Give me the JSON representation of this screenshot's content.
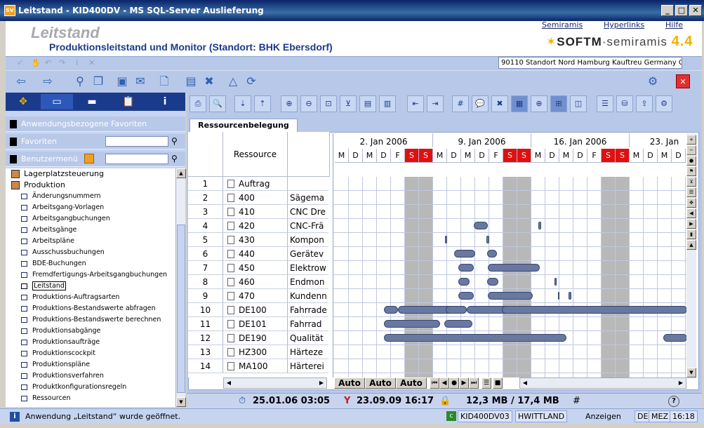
{
  "window": {
    "title": "Leitstand - KID400DV - MS SQL-Server Auslieferung",
    "app_icon": "sv",
    "buttons": {
      "minimize": "_",
      "maximize": "□",
      "close": "✕"
    }
  },
  "header": {
    "title": "Leitstand",
    "subtitle": "Produktionsleitstand und Monitor (Standort: BHK Ebersdorf)",
    "links": [
      "Semiramis",
      "Hyperlinks",
      "Hilfe"
    ],
    "logo": {
      "brand": "SOFTM",
      "product": "semiramis",
      "version": "4.4"
    },
    "address": "90110 Standort Nord Hamburg Kauftreu Germany G"
  },
  "sidebar": {
    "sections": {
      "app_favorites": "Anwendungsbezogene Favoriten",
      "favorites": "Favoriten",
      "user_menu": "Benutzermenü"
    },
    "tree": [
      {
        "label": "Lagerplatzsteuerung",
        "level": 0
      },
      {
        "label": "Produktion",
        "level": 0
      },
      {
        "label": "Änderungsnummern",
        "level": 1
      },
      {
        "label": "Arbeitsgang-Vorlagen",
        "level": 1
      },
      {
        "label": "Arbeitsgangbuchungen",
        "level": 1
      },
      {
        "label": "Arbeitsgänge",
        "level": 1
      },
      {
        "label": "Arbeitspläne",
        "level": 1
      },
      {
        "label": "Ausschussbuchungen",
        "level": 1
      },
      {
        "label": "BDE-Buchungen",
        "level": 1
      },
      {
        "label": "Fremdfertigungs-Arbeitsgangbuchungen",
        "level": 1
      },
      {
        "label": "Leitstand",
        "level": 1,
        "selected": true
      },
      {
        "label": "Produktions-Auftragsarten",
        "level": 1
      },
      {
        "label": "Produktions-Bestandswerte abfragen",
        "level": 1
      },
      {
        "label": "Produktions-Bestandswerte berechnen",
        "level": 1
      },
      {
        "label": "Produktionsabgänge",
        "level": 1
      },
      {
        "label": "Produktionsaufträge",
        "level": 1
      },
      {
        "label": "Produktionscockpit",
        "level": 1
      },
      {
        "label": "Produktionspläne",
        "level": 1
      },
      {
        "label": "Produktionsverfahren",
        "level": 1
      },
      {
        "label": "Produktkonfigurationsregeln",
        "level": 1
      },
      {
        "label": "Ressourcen",
        "level": 1
      }
    ]
  },
  "main": {
    "tab": "Ressourcenbelegung",
    "column_header": "Ressource",
    "rows": [
      {
        "num": "1",
        "res": "Auftrag",
        "desc": ""
      },
      {
        "num": "2",
        "res": "400",
        "desc": "Sägema"
      },
      {
        "num": "3",
        "res": "410",
        "desc": "CNC Dre"
      },
      {
        "num": "4",
        "res": "420",
        "desc": "CNC-Frä"
      },
      {
        "num": "5",
        "res": "430",
        "desc": "Kompon"
      },
      {
        "num": "6",
        "res": "440",
        "desc": "Gerätev"
      },
      {
        "num": "7",
        "res": "450",
        "desc": "Elektrow"
      },
      {
        "num": "8",
        "res": "460",
        "desc": "Endmon"
      },
      {
        "num": "9",
        "res": "470",
        "desc": "Kundenn"
      },
      {
        "num": "10",
        "res": "DE100",
        "desc": "Fahrrade"
      },
      {
        "num": "11",
        "res": "DE101",
        "desc": "Fahrrad"
      },
      {
        "num": "12",
        "res": "DE190",
        "desc": "Qualität"
      },
      {
        "num": "13",
        "res": "HZ300",
        "desc": "Härteze"
      },
      {
        "num": "14",
        "res": "MA100",
        "desc": "Härterei"
      }
    ],
    "weeks": [
      "2. Jan 2006",
      "9. Jan 2006",
      "16. Jan 2006",
      "23. Jan"
    ],
    "days": [
      "M",
      "D",
      "M",
      "D",
      "F",
      "S",
      "S",
      "M",
      "D",
      "M",
      "D",
      "F",
      "S",
      "S",
      "M",
      "D",
      "M",
      "D",
      "F",
      "S",
      "S",
      "M",
      "D",
      "M",
      "D"
    ],
    "auto_buttons": [
      "Auto",
      "Auto",
      "Auto"
    ]
  },
  "infobar": {
    "date1": "25.01.06 03:05",
    "date2": "23.09.09 16:17",
    "memory": "12,3 MB / 17,4 MB",
    "help": "?"
  },
  "statusbar": {
    "message": "Anwendung „Leitstand“ wurde geöffnet.",
    "server": "KID400DV03",
    "user": "HWITTLAND",
    "mode": "Anzeigen",
    "lang": "DE",
    "tz": "MEZ",
    "time": "16:18"
  }
}
